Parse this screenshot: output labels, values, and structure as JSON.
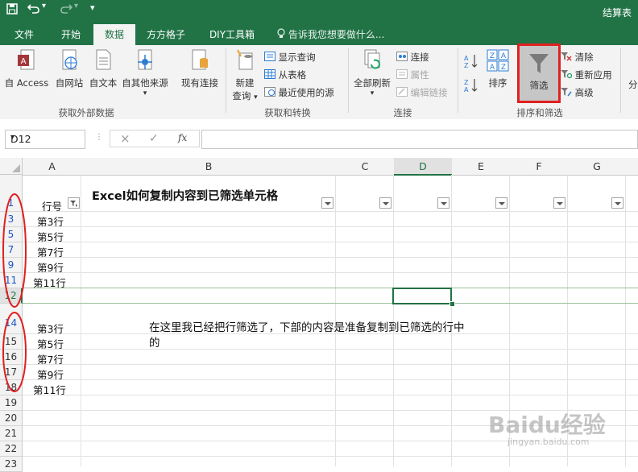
{
  "window": {
    "title": "结算表"
  },
  "quick_access": {
    "save_icon": "save-icon",
    "undo_icon": "undo-icon",
    "redo_icon": "redo-icon",
    "customize_icon": "customize-icon"
  },
  "tabs": [
    {
      "label": "文件"
    },
    {
      "label": "开始"
    },
    {
      "label": "数据"
    },
    {
      "label": "方方格子"
    },
    {
      "label": "DIY工具箱"
    }
  ],
  "tell_me": "告诉我您想要做什么...",
  "ribbon": {
    "get_external": {
      "group_label": "获取外部数据",
      "buttons": [
        "自 Access",
        "自网站",
        "自文本",
        "自其他来源",
        "现有连接"
      ]
    },
    "get_transform": {
      "group_label": "获取和转换",
      "new_query_1": "新建",
      "new_query_2": "查询",
      "show_query": "显示查询",
      "from_table": "从表格",
      "recent_sources": "最近使用的源"
    },
    "connections": {
      "group_label": "连接",
      "refresh_all": "全部刷新",
      "connections": "连接",
      "properties": "属性",
      "edit_links": "编辑链接"
    },
    "sort_filter": {
      "group_label": "排序和筛选",
      "sort": "排序",
      "filter": "筛选",
      "clear": "清除",
      "reapply": "重新应用",
      "advanced": "高级"
    },
    "next_group_partial": "分"
  },
  "formula_bar": {
    "name_box": "D12",
    "cancel_icon": "×",
    "enter_icon": "✓",
    "fx": "fx",
    "value": ""
  },
  "columns": [
    "A",
    "B",
    "C",
    "D",
    "E",
    "F",
    "G"
  ],
  "selected_column": "D",
  "rows": [
    "1",
    "3",
    "5",
    "7",
    "9",
    "11",
    "12",
    "14",
    "15",
    "16",
    "17",
    "18",
    "19",
    "20",
    "21",
    "22",
    "23"
  ],
  "cells": {
    "header_a1": "行号",
    "title_b1": "Excel如何复制内容到已筛选单元格",
    "top_list": [
      "第3行",
      "第5行",
      "第7行",
      "第9行",
      "第11行"
    ],
    "bottom_list": [
      "第3行",
      "第5行",
      "第7行",
      "第9行",
      "第11行"
    ],
    "note_line1": "在这里我已经把行筛选了，下部的内容是准备复制到已筛选的行中",
    "note_line2": "的"
  },
  "colors": {
    "excel_green": "#217346",
    "highlight_red": "#e02020",
    "filtered_row_blue": "#1a55c8"
  },
  "watermark": {
    "text": "Baidu经验",
    "url": "jingyan.baidu.com"
  }
}
